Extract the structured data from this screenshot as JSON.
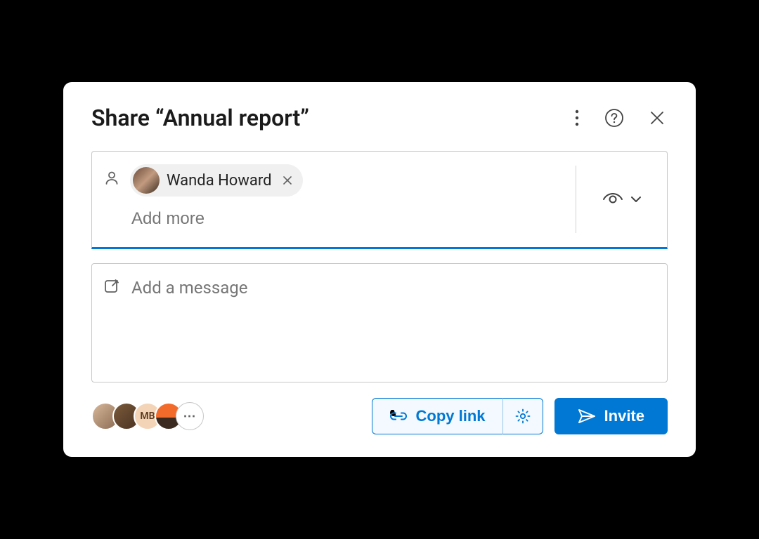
{
  "header": {
    "title": "Share “Annual report”"
  },
  "recipients": {
    "chips": [
      {
        "name": "Wanda Howard"
      }
    ],
    "add_more_placeholder": "Add more",
    "permission_label": "Can view"
  },
  "message": {
    "placeholder": "Add a message"
  },
  "shared_with": {
    "faces": [
      {
        "initials": ""
      },
      {
        "initials": ""
      },
      {
        "initials": "MB"
      },
      {
        "initials": ""
      }
    ],
    "more_label": "⋯"
  },
  "actions": {
    "copy_link": "Copy link",
    "invite": "Invite"
  }
}
